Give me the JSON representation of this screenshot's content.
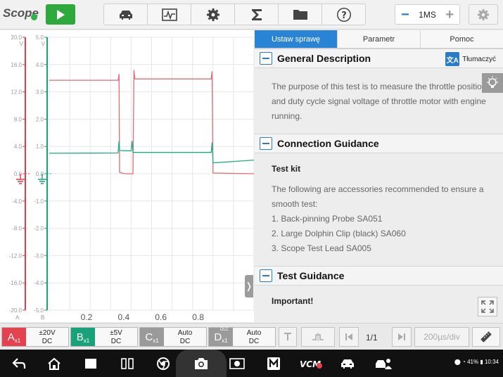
{
  "topbar": {
    "brand": "Scope",
    "zoom_value": "1MS",
    "zoom_minus": "−",
    "zoom_plus": "+",
    "tools": [
      "car-icon",
      "waveform-icon",
      "gear-icon",
      "sigma-icon",
      "folder-icon",
      "help-icon"
    ]
  },
  "chart_data": {
    "type": "line",
    "x_ticks": [
      "0.2",
      "0.4",
      "0.6",
      "0.8"
    ],
    "axis_bottom_labels": [
      "A",
      "B"
    ],
    "xlim": [
      0,
      1.1
    ],
    "axes": [
      {
        "channel": "A",
        "unit": "V",
        "color": "#e03c4a",
        "range": [
          -20,
          20
        ],
        "ticks": [
          "20.0",
          "16.0",
          "12.0",
          "8.0",
          "4.0",
          "0.0",
          "-4.0",
          "-8.0",
          "-12.0",
          "-16.0",
          "-20.0"
        ]
      },
      {
        "channel": "B",
        "unit": "V",
        "color": "#18a27a",
        "range": [
          -5,
          5
        ],
        "ticks": [
          "5.0",
          "4.0",
          "3.0",
          "2.0",
          "1.0",
          "0.0",
          "-1.0",
          "-2.0",
          "-3.0",
          "-4.0",
          "-5.0"
        ]
      }
    ],
    "series": [
      {
        "channel": "A",
        "color": "#e06c74",
        "x": [
          0,
          0.37,
          0.375,
          0.378,
          0.405,
          0.415,
          0.45,
          0.455,
          0.46,
          0.87,
          0.875,
          0.88,
          1.1
        ],
        "y": [
          13.7,
          13.7,
          14.6,
          0.2,
          0.0,
          0.0,
          0.0,
          15.2,
          13.9,
          13.9,
          15.0,
          0.1,
          0.0
        ]
      },
      {
        "channel": "B",
        "color": "#1fae84",
        "x": [
          0,
          0.37,
          0.375,
          0.378,
          0.44,
          0.445,
          0.45,
          0.455,
          0.87,
          0.875,
          0.88,
          1.1
        ],
        "y": [
          0.75,
          0.76,
          1.2,
          0.85,
          0.84,
          1.2,
          0.78,
          0.78,
          0.78,
          1.15,
          0.4,
          0.5
        ]
      }
    ]
  },
  "panel": {
    "tabs": [
      "Ustaw sprawę",
      "Parametr",
      "Pomoc"
    ],
    "translate_label": "Tłumaczyć",
    "sections": [
      {
        "title": "General Description",
        "paragraphs": [
          "The purpose of this test is to measure the throttle position and duty cycle signal voltage of throttle motor with engine running."
        ]
      },
      {
        "title": "Connection Guidance",
        "subtitle": "Test kit",
        "paragraphs": [
          "The following are accessories recommended to ensure a smooth test:",
          "1. Back-pinning Probe SA051",
          "2. Large Dolphin Clip (black) SA060",
          "3. Scope Test Lead SA005"
        ]
      },
      {
        "title": "Test Guidance",
        "subtitle": "Important!"
      }
    ]
  },
  "channels": [
    {
      "letter": "A",
      "mult": "x1",
      "range": "±20V",
      "coupling": "DC",
      "color": "#e5424f"
    },
    {
      "letter": "B",
      "mult": "x1",
      "range": "±5V",
      "coupling": "DC",
      "color": "#18a27a"
    },
    {
      "letter": "C",
      "mult": "x1",
      "range": "Auto",
      "coupling": "DC",
      "color": "#9a9a9a"
    },
    {
      "letter": "D",
      "mult": "x1",
      "tag": "DLC",
      "range": "Auto",
      "coupling": "DC",
      "color": "#9a9a9a"
    }
  ],
  "controls": {
    "page": "1/1",
    "timebase": "200µs/div"
  },
  "status": {
    "battery": "41%",
    "time": "10:34"
  }
}
